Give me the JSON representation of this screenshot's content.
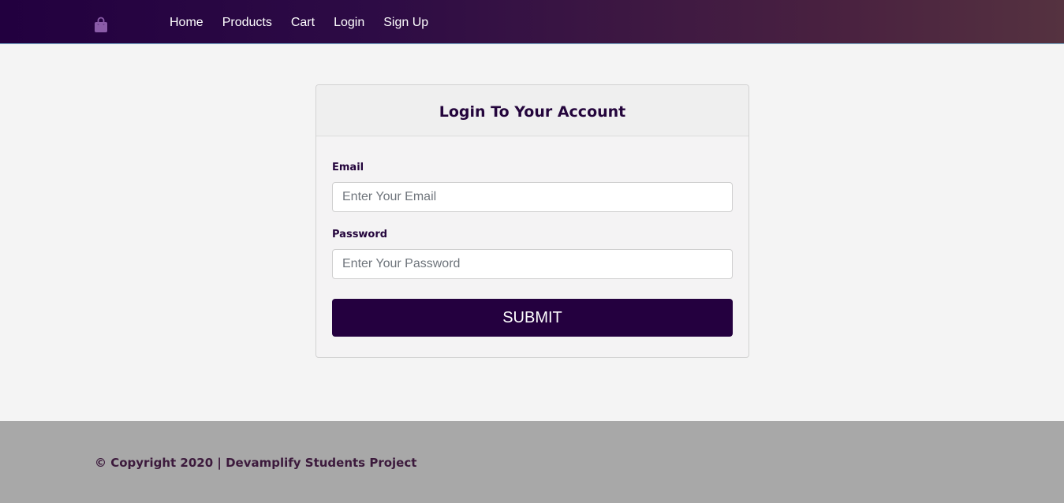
{
  "navbar": {
    "brand_icon": "shopping-bag-icon",
    "links": [
      {
        "label": "Home"
      },
      {
        "label": "Products"
      },
      {
        "label": "Cart"
      },
      {
        "label": "Login"
      },
      {
        "label": "Sign Up"
      }
    ]
  },
  "login_card": {
    "title": "Login To Your Account",
    "email_label": "Email",
    "email_placeholder": "Enter Your Email",
    "email_value": "",
    "password_label": "Password",
    "password_placeholder": "Enter Your Password",
    "password_value": "",
    "submit_label": "SUBMIT"
  },
  "footer": {
    "copyright": "© Copyright 2020 | Devamplify Students Project"
  },
  "colors": {
    "brand_dark": "#24003f",
    "accent_purple": "#8a5ca8",
    "footer_bg": "#a8a8a8"
  }
}
